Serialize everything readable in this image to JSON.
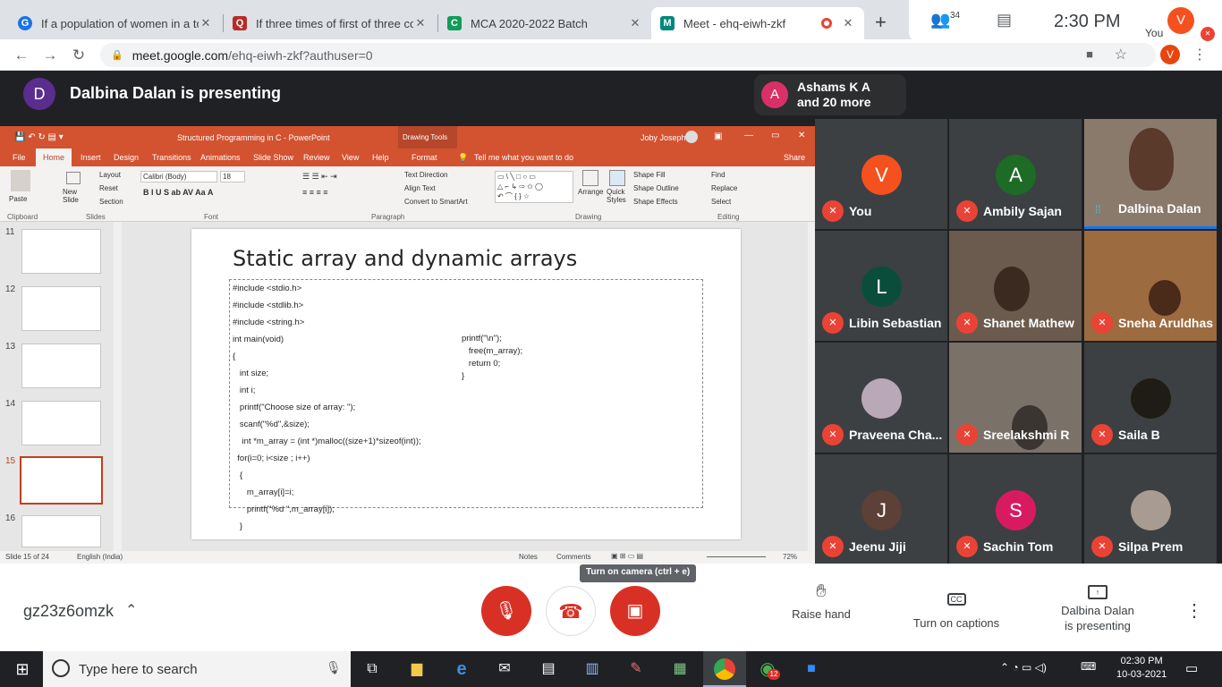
{
  "browser": {
    "tabs": [
      {
        "title": "If a population of women in a to",
        "favicon": "G",
        "color": "#1a73e8"
      },
      {
        "title": "If three times of first of three con",
        "favicon": "Q",
        "color": "#b92b27"
      },
      {
        "title": "MCA 2020-2022 Batch",
        "favicon": "C",
        "color": "#0f9d58"
      },
      {
        "title": "Meet - ehq-eiwh-zkf",
        "favicon": "M",
        "color": "#00897b"
      }
    ],
    "new_tab": "+",
    "url_host": "meet.google.com",
    "url_path": "/ehq-eiwh-zkf?authuser=0",
    "profile_initial": "V"
  },
  "meet": {
    "presenter_initial": "D",
    "presenting_text": "Dalbina Dalan is presenting",
    "notification": {
      "initial": "A",
      "line1": "Ashams K A",
      "line2": "and 20 more"
    },
    "participant_count": "34",
    "time": "2:30 PM",
    "you_label": "You",
    "you_initial": "V",
    "meeting_code": "gz23z6omzk",
    "tooltip": "Turn on camera (ctrl + e)",
    "raise_hand": "Raise hand",
    "captions": "Turn on captions",
    "presenting_line1": "Dalbina Dalan",
    "presenting_line2": "is presenting",
    "participants": [
      {
        "name": "You",
        "initial": "V",
        "color": "#f4511e",
        "type": "avatar"
      },
      {
        "name": "Ambily Sajan",
        "initial": "A",
        "color": "#1e6b26",
        "type": "avatar"
      },
      {
        "name": "Dalbina Dalan",
        "initial": "",
        "color": "#8a7a6c",
        "type": "video"
      },
      {
        "name": "Libin Sebastian",
        "initial": "L",
        "color": "#0b4d3b",
        "type": "avatar"
      },
      {
        "name": "Shanet Mathew",
        "initial": "",
        "color": "#6b5b4e",
        "type": "video"
      },
      {
        "name": "Sneha Aruldhas",
        "initial": "",
        "color": "#9c6b3f",
        "type": "video"
      },
      {
        "name": "Praveena Cha...",
        "initial": "",
        "color": "#b9a8b8",
        "type": "photo"
      },
      {
        "name": "Sreelakshmi R",
        "initial": "",
        "color": "#7a7268",
        "type": "video"
      },
      {
        "name": "Saila B",
        "initial": "",
        "color": "#1e1c14",
        "type": "photo"
      },
      {
        "name": "Jeenu Jiji",
        "initial": "J",
        "color": "#5d4037",
        "type": "avatar"
      },
      {
        "name": "Sachin Tom",
        "initial": "S",
        "color": "#d81b60",
        "type": "avatar"
      },
      {
        "name": "Silpa Prem",
        "initial": "",
        "color": "#a89c92",
        "type": "photo"
      }
    ]
  },
  "ppt": {
    "title": "Structured Programming in C - PowerPoint",
    "drawing_tools": "Drawing Tools",
    "user": "Joby Joseph",
    "menu": [
      "File",
      "Home",
      "Insert",
      "Design",
      "Transitions",
      "Animations",
      "Slide Show",
      "Review",
      "View",
      "Help",
      "Format"
    ],
    "tell_me": "Tell me what you want to do",
    "share": "Share",
    "ribbon_groups": [
      "Clipboard",
      "Slides",
      "Font",
      "Paragraph",
      "Drawing",
      "Editing"
    ],
    "ribbon_items": {
      "paste": "Paste",
      "new_slide": "New Slide",
      "layout": "Layout",
      "reset": "Reset",
      "section": "Section",
      "font": "Calibri (Body)",
      "size": "18",
      "text_direction": "Text Direction",
      "align_text": "Align Text",
      "smartart": "Convert to SmartArt",
      "arrange": "Arrange",
      "quick_styles": "Quick Styles",
      "shape_fill": "Shape Fill",
      "shape_outline": "Shape Outline",
      "shape_effects": "Shape Effects",
      "find": "Find",
      "replace": "Replace",
      "select": "Select"
    },
    "thumb_numbers": [
      "11",
      "12",
      "13",
      "14",
      "15",
      "16"
    ],
    "slide_title": "Static array and dynamic arrays",
    "code_left": [
      "#include <stdio.h>",
      "#include <stdlib.h>",
      "#include <string.h>",
      "int main(void)",
      "{",
      "   int size;",
      "   int i;",
      "   printf(\"Choose size of array: \");",
      "   scanf(\"%d\",&size);",
      "    int *m_array = (int *)malloc((size+1)*sizeof(int));",
      "  for(i=0; i<size ; i++)",
      "   {",
      "      m_array[i]=i;",
      "      printf(\"%d \",m_array[i]);",
      "   }"
    ],
    "code_right": [
      "printf(\"\\n\");",
      "   free(m_array);",
      "   return 0;",
      "}"
    ],
    "status_slide": "Slide 15 of 24",
    "status_lang": "English (India)",
    "notes": "Notes",
    "comments": "Comments",
    "zoom": "72%"
  },
  "taskbar": {
    "search_placeholder": "Type here to search",
    "time": "02:30 PM",
    "date": "10-03-2021",
    "whatsapp_badge": "12"
  }
}
